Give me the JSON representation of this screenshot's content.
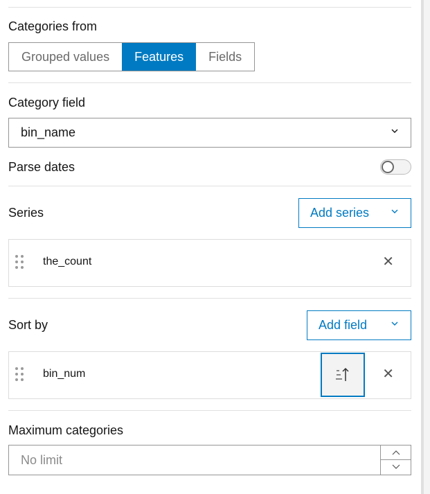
{
  "categories_from": {
    "label": "Categories from",
    "options": [
      "Grouped values",
      "Features",
      "Fields"
    ],
    "selected": "Features"
  },
  "category_field": {
    "label": "Category field",
    "value": "bin_name"
  },
  "parse_dates": {
    "label": "Parse dates",
    "enabled": false
  },
  "series": {
    "label": "Series",
    "add_label": "Add series",
    "items": [
      {
        "name": "the_count"
      }
    ]
  },
  "sort_by": {
    "label": "Sort by",
    "add_label": "Add field",
    "items": [
      {
        "name": "bin_num",
        "order": "ascending"
      }
    ]
  },
  "max_categories": {
    "label": "Maximum categories",
    "placeholder": "No limit"
  },
  "colors": {
    "accent": "#007ac2"
  }
}
